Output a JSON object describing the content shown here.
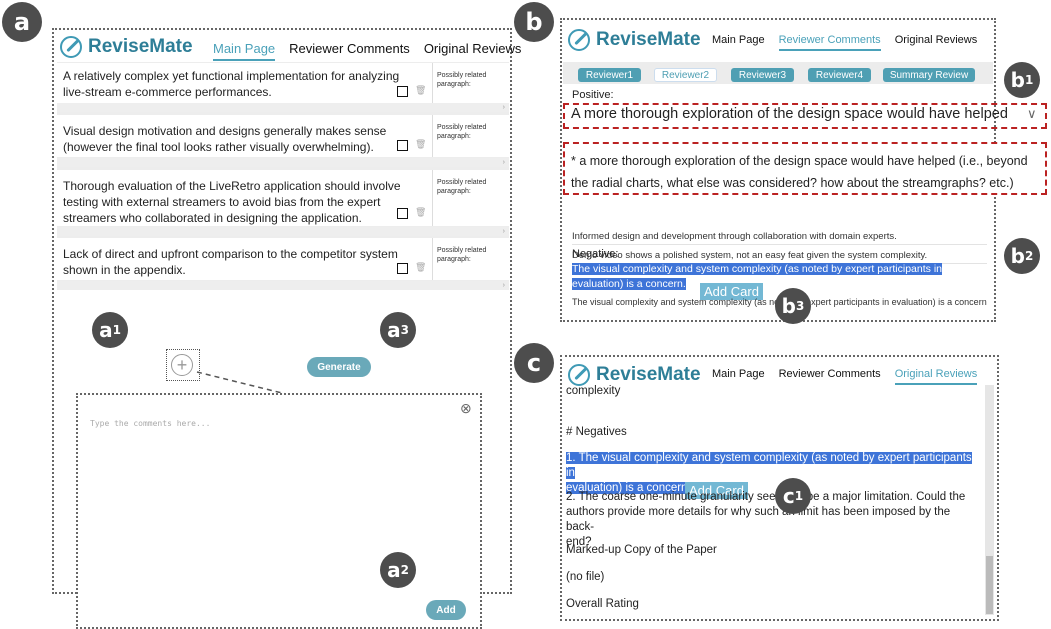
{
  "panel_labels": {
    "a": "a",
    "b": "b",
    "c": "c",
    "a1": "a",
    "a1_sub": "1",
    "a2": "a",
    "a2_sub": "2",
    "a3": "a",
    "a3_sub": "3",
    "b1": "b",
    "b1_sub": "1",
    "b2": "b",
    "b2_sub": "2",
    "b3": "b",
    "b3_sub": "3",
    "c1": "c",
    "c1_sub": "1"
  },
  "app_name": "ReviseMate",
  "nav": {
    "main": "Main Page",
    "reviewer": "Reviewer Comments",
    "original": "Original Reviews"
  },
  "cards": [
    {
      "text": "A relatively complex yet functional implementation for analyzing live-stream e-commerce performances.",
      "side": "Possibly related paragraph:"
    },
    {
      "text": "Visual design motivation and designs generally makes sense (however the final tool looks rather visually overwhelming).",
      "side": "Possibly related paragraph:"
    },
    {
      "text": "Thorough evaluation of the LiveRetro application should involve testing with external streamers to avoid bias from the expert streamers who collaborated in designing the application.",
      "side": "Possibly related paragraph:"
    },
    {
      "text": "Lack of direct and upfront comparison to the competitor system shown in the appendix.",
      "side": "Possibly related paragraph:"
    }
  ],
  "strip_arrow": "›",
  "generate_label": "Generate",
  "comment_placeholder": "Type the comments here...",
  "add_label": "Add",
  "close_glyph": "⊗",
  "plus_glyph": "+",
  "reviewer_tabs": [
    "Reviewer1",
    "Reviewer2",
    "Reviewer3",
    "Reviewer4",
    "Summary Review"
  ],
  "positive_label": "Positive:",
  "dropdown_text": "A more thorough exploration of the design space would have helped",
  "dropdown_chevron": "∨",
  "expanded_text": "* a more thorough exploration of the design space would have helped (i.e., beyond the radial charts, what else was considered? how about the streamgraphs? etc.)",
  "positive_rows": [
    "Informed design and development through collaboration with domain experts.",
    "Demo video shows a polished system, not an easy feat given the system complexity."
  ],
  "negative_label": "Negative:",
  "negative_highlight": "The visual complexity and system complexity (as noted by expert participants in evaluation) is a concern.",
  "negative_row": "The visual complexity and system complexity (as noted by expert participants in evaluation) is a concern",
  "add_card": "Add Card",
  "original": {
    "line0": "complexity",
    "negatives": "# Negatives",
    "hl1": "1. The visual complexity and system complexity (as noted by expert participants in",
    "hl2": "evaluation) is a concern",
    "item2a": "2. The coarse one-minute granularity seems to be a major limitation. Could the",
    "item2b": "authors provide more details for why such an limit has been imposed by the back-",
    "item2c": "end?",
    "markup": "Marked-up Copy of the Paper",
    "nofile": "(no file)",
    "rating": "Overall Rating"
  }
}
